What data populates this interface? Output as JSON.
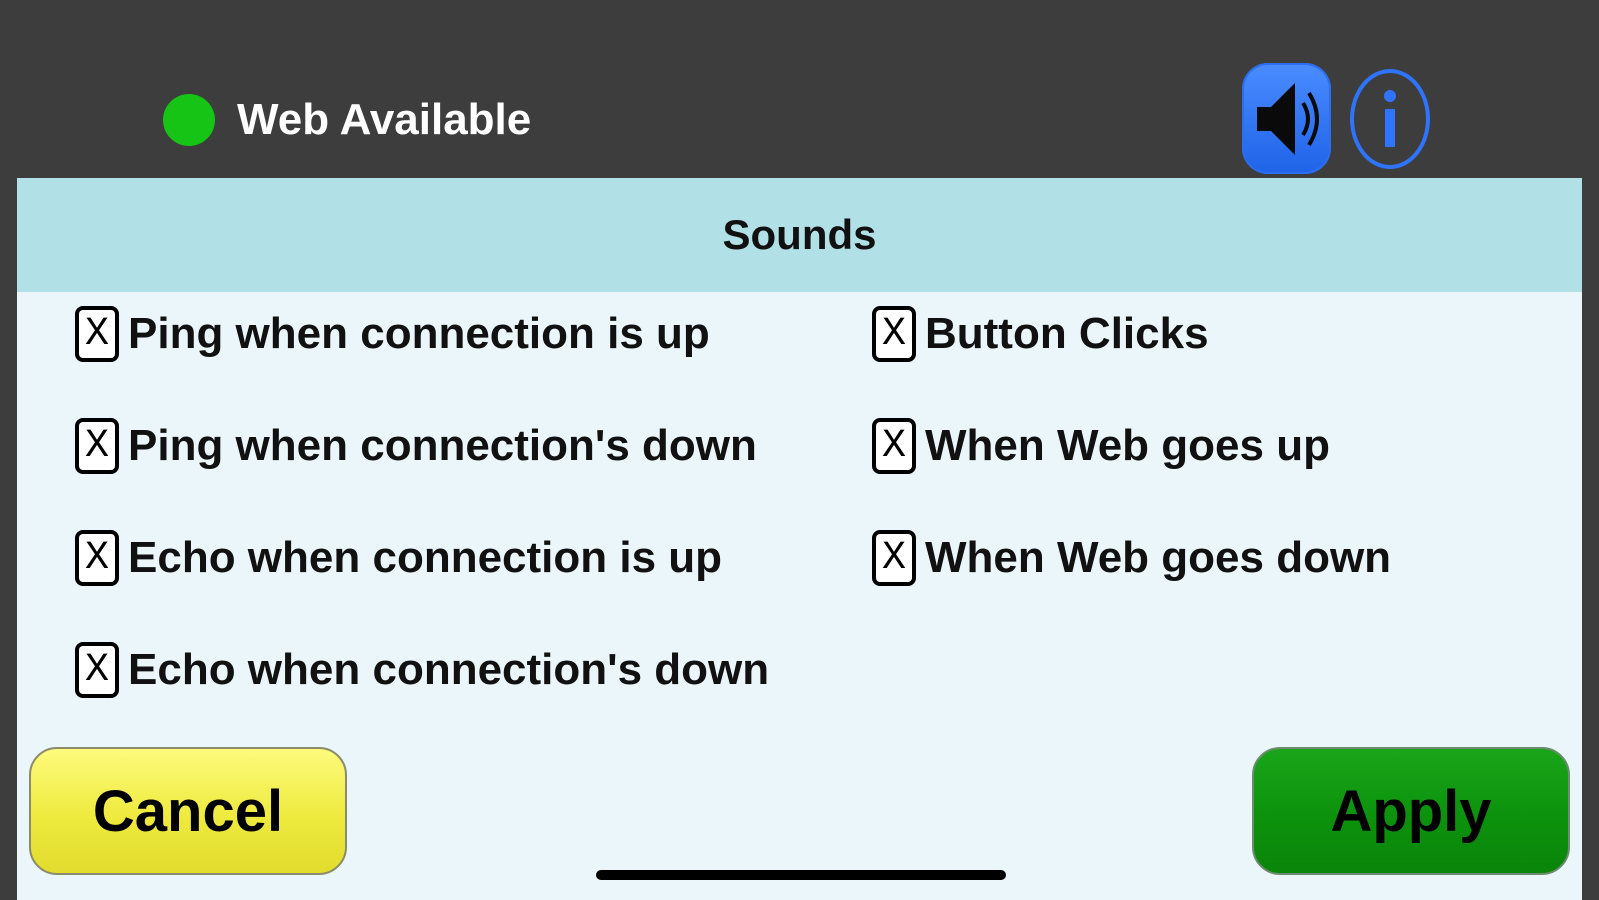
{
  "status": {
    "label": "Web Available",
    "indicator_color": "#16c416"
  },
  "toolbar": {
    "sound_icon": "speaker-icon",
    "info_icon": "info-icon"
  },
  "panel": {
    "title": "Sounds",
    "options": [
      {
        "mark": "X",
        "label": "Ping when connection is up",
        "checked": true
      },
      {
        "mark": "X",
        "label": "Ping when connection's down",
        "checked": true
      },
      {
        "mark": "X",
        "label": "Echo when connection is up",
        "checked": true
      },
      {
        "mark": "X",
        "label": "Echo when connection's down",
        "checked": true
      },
      {
        "mark": "X",
        "label": "Button Clicks",
        "checked": true
      },
      {
        "mark": "X",
        "label": "When Web goes up",
        "checked": true
      },
      {
        "mark": "X",
        "label": "When Web goes down",
        "checked": true
      }
    ]
  },
  "buttons": {
    "cancel_label": "Cancel",
    "apply_label": "Apply"
  },
  "colors": {
    "background": "#3d3d3d",
    "header": "#b1e1e6",
    "panel": "#ebf6fb",
    "cancel": "#eeea3e",
    "apply": "#0c920c",
    "accent": "#2f74ff"
  }
}
